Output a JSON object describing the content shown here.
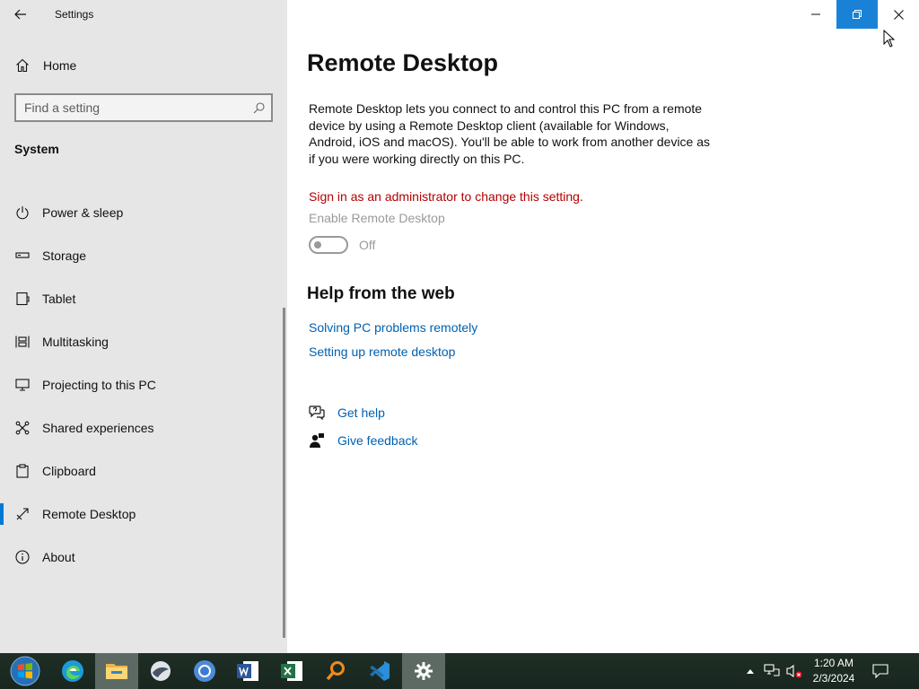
{
  "app": {
    "title": "Settings"
  },
  "sidebar": {
    "home_label": "Home",
    "search_placeholder": "Find a setting",
    "section_label": "System",
    "items": [
      {
        "label": "Power & sleep",
        "icon": "power-icon"
      },
      {
        "label": "Storage",
        "icon": "storage-icon"
      },
      {
        "label": "Tablet",
        "icon": "tablet-icon"
      },
      {
        "label": "Multitasking",
        "icon": "multitasking-icon"
      },
      {
        "label": "Projecting to this PC",
        "icon": "projecting-icon"
      },
      {
        "label": "Shared experiences",
        "icon": "shared-experiences-icon"
      },
      {
        "label": "Clipboard",
        "icon": "clipboard-icon"
      },
      {
        "label": "Remote Desktop",
        "icon": "remote-desktop-icon",
        "active": true
      },
      {
        "label": "About",
        "icon": "about-icon"
      }
    ]
  },
  "main": {
    "title": "Remote Desktop",
    "description": "Remote Desktop lets you connect to and control this PC from a remote device by using a Remote Desktop client (available for Windows, Android, iOS and macOS). You'll be able to work from another device as if you were working directly on this PC.",
    "admin_warning": "Sign in as an administrator to change this setting.",
    "toggle_label": "Enable Remote Desktop",
    "toggle_state": "Off",
    "help_title": "Help from the web",
    "links": [
      "Solving PC problems remotely",
      "Setting up remote desktop"
    ],
    "get_help": "Get help",
    "give_feedback": "Give feedback"
  },
  "taskbar": {
    "apps": [
      "start-button",
      "edge-icon",
      "file-explorer-icon",
      "app-icon",
      "chrome-icon",
      "word-icon",
      "excel-icon",
      "search-app-icon",
      "vscode-icon",
      "settings-icon"
    ],
    "time": "1:20 AM",
    "date": "2/3/2024"
  },
  "colors": {
    "accent": "#0078d7",
    "link": "#0060b0",
    "warning": "#b30000",
    "sidebar_bg": "#e6e6e6"
  }
}
